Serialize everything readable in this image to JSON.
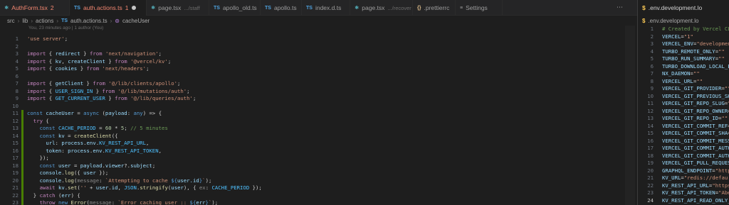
{
  "tabs": [
    {
      "icon": "react-icon",
      "label": "AuthForm.tsx",
      "meta": "",
      "badge": "2",
      "state": "error"
    },
    {
      "icon": "typescript-icon",
      "label": "auth.actions.ts",
      "meta": "",
      "badge": "1",
      "state": "active"
    },
    {
      "icon": "react-icon",
      "label": "page.tsx",
      "meta": ".../staff",
      "badge": "",
      "state": ""
    },
    {
      "icon": "typescript-icon",
      "label": "apollo_old.ts",
      "meta": "",
      "badge": "",
      "state": ""
    },
    {
      "icon": "typescript-icon",
      "label": "apollo.ts",
      "meta": "",
      "badge": "",
      "state": ""
    },
    {
      "icon": "typescript-icon",
      "label": "index.d.ts",
      "meta": "",
      "badge": "",
      "state": ""
    },
    {
      "icon": "react-icon",
      "label": "page.tsx",
      "meta": ".../recover",
      "badge": "",
      "state": ""
    },
    {
      "icon": "json-icon",
      "label": ".prettierrc",
      "meta": "",
      "badge": "",
      "state": ""
    },
    {
      "icon": "settings-icon",
      "label": "Settings",
      "meta": "",
      "badge": "",
      "state": ""
    }
  ],
  "breadcrumb": {
    "parts": [
      "src",
      "lib",
      "actions"
    ],
    "file": "auth.actions.ts",
    "symbol": "cacheUser"
  },
  "blame": "You, 23 minutes ago | 1 author (You)",
  "code_lines": [
    "'use server';",
    "",
    "import { redirect } from 'next/navigation';",
    "import { kv, createClient } from '@vercel/kv';",
    "import { cookies } from 'next/headers';",
    "",
    "import { getClient } from '@/lib/clients/apollo';",
    "import { USER_SIGN_IN } from '@/lib/mutations/auth';",
    "import { GET_CURRENT_USER } from '@/lib/queries/auth';",
    "",
    "const cacheUser = async (payload: any) => {",
    "  try {",
    "    const CACHE_PERIOD = 60 * 5; // 5 minutes",
    "    const kv = createClient({",
    "      url: process.env.KV_REST_API_URL,",
    "      token: process.env.KV_REST_API_TOKEN,",
    "    });",
    "    const user = payload.viewer?.subject;",
    "    console.log({ user });",
    "    console.log(message: `Attempting to cache ${user.id}`);",
    "    await kv.set('' + user.id, JSON.stringify(user), { ex: CACHE_PERIOD });",
    "  } catch (err) {",
    "    throw new Error(message: `Error caching user :: ${err}`);",
    "  }"
  ],
  "current_line": 24,
  "right_panel": {
    "tab_label": ".env.development.lo",
    "breadcrumb": ".env.development.lo",
    "lines": [
      "# Created by Vercel CL",
      "VERCEL=\"1\"",
      "VERCEL_ENV=\"developmen",
      "TURBO_REMOTE_ONLY=\"\"",
      "TURBO_RUN_SUMMARY=\"\"",
      "TURBO_DOWNLOAD_LOCAL_E",
      "NX_DAEMON=\"\"",
      "VERCEL_URL=\"\"",
      "VERCEL_GIT_PROVIDER=\"\"",
      "VERCEL_GIT_PREVIOUS_SH",
      "VERCEL_GIT_REPO_SLUG=\"",
      "VERCEL_GIT_REPO_OWNER=",
      "VERCEL_GIT_REPO_ID=\"\"",
      "VERCEL_GIT_COMMIT_REF=",
      "VERCEL_GIT_COMMIT_SHA=",
      "VERCEL_GIT_COMMIT_MESS",
      "VERCEL_GIT_COMMIT_AUTH",
      "VERCEL_GIT_COMMIT_AUTH",
      "VERCEL_GIT_PULL_REQUES",
      "GRAPHQL_ENDPOINT=\"http",
      "KV_URL=\"redis://defau",
      "KV_REST_API_URL=\"https",
      "KV_REST_API_TOKEN=\"Abe",
      "KV_REST_API_READ_ONLY_"
    ],
    "current_line": 24
  }
}
